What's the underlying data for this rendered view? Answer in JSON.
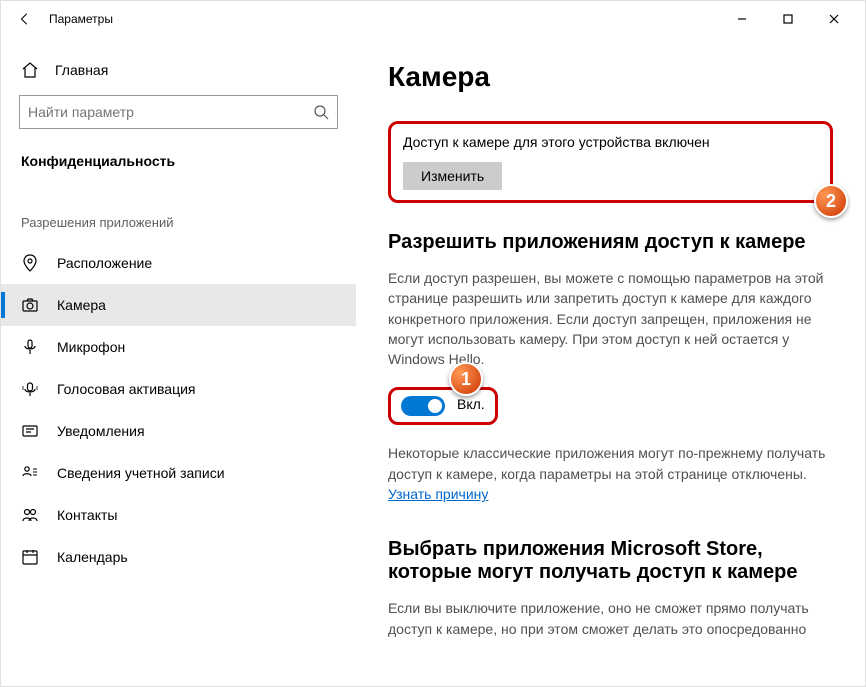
{
  "window": {
    "title": "Параметры"
  },
  "sidebar": {
    "home": "Главная",
    "search_placeholder": "Найти параметр",
    "section": "Конфиденциальность",
    "group": "Разрешения приложений",
    "items": [
      {
        "label": "Расположение"
      },
      {
        "label": "Камера"
      },
      {
        "label": "Микрофон"
      },
      {
        "label": "Голосовая активация"
      },
      {
        "label": "Уведомления"
      },
      {
        "label": "Сведения учетной записи"
      },
      {
        "label": "Контакты"
      },
      {
        "label": "Календарь"
      }
    ]
  },
  "main": {
    "title": "Камера",
    "device_status": "Доступ к камере для этого устройства включен",
    "change_btn": "Изменить",
    "allow_title": "Разрешить приложениям доступ к камере",
    "allow_desc": "Если доступ разрешен, вы можете с помощью параметров на этой странице разрешить или запретить доступ к камере для каждого конкретного приложения. Если доступ запрещен, приложения не могут использовать камеру. При этом доступ к ней остается у Windows Hello.",
    "toggle_label": "Вкл.",
    "toggle_on": true,
    "classic_note_pre": "Некоторые классические приложения могут по-прежнему получать доступ к камере, когда параметры на этой странице отключены. ",
    "classic_note_link": "Узнать причину",
    "store_title": "Выбрать приложения Microsoft Store, которые могут получать доступ к камере",
    "store_desc": "Если вы выключите приложение, оно не сможет прямо получать доступ к камере, но при этом сможет делать это опосредованно"
  },
  "annotations": {
    "b1": "1",
    "b2": "2"
  }
}
